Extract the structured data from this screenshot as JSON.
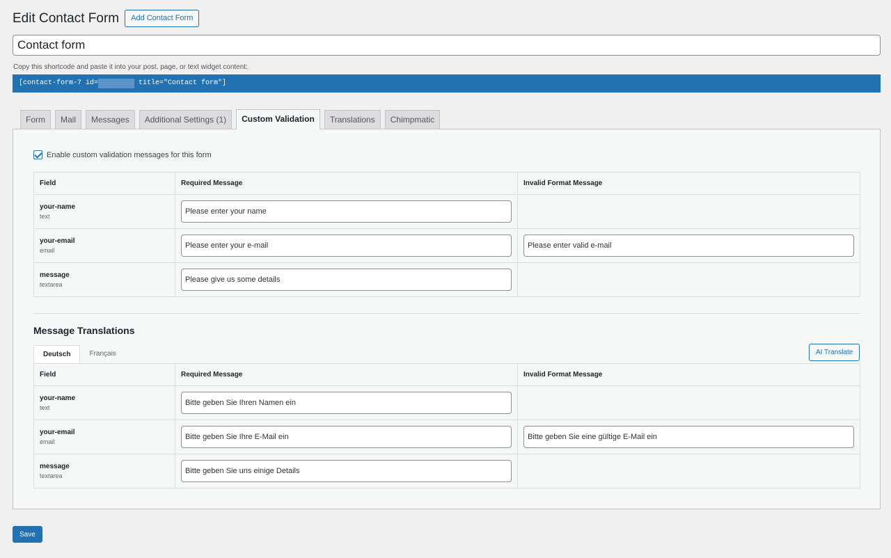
{
  "header": {
    "title": "Edit Contact Form",
    "add_button": "Add Contact Form"
  },
  "form_title": "Contact form",
  "shortcode": {
    "hint": "Copy this shortcode and paste it into your post, page, or text widget content:",
    "prefix": "[contact-form-7 id=",
    "suffix": " title=\"Contact form\"]"
  },
  "tabs": [
    {
      "label": "Form"
    },
    {
      "label": "Mail"
    },
    {
      "label": "Messages"
    },
    {
      "label": "Additional Settings (1)"
    },
    {
      "label": "Custom Validation",
      "active": true
    },
    {
      "label": "Translations"
    },
    {
      "label": "Chimpmatic"
    }
  ],
  "custom_validation": {
    "enable_label": "Enable custom validation messages for this form",
    "enabled": true,
    "columns": [
      "Field",
      "Required Message",
      "Invalid Format Message"
    ],
    "rows": [
      {
        "field": "your-name",
        "type": "text",
        "required": "Please enter your name",
        "invalid": null
      },
      {
        "field": "your-email",
        "type": "email",
        "required": "Please enter your e-mail",
        "invalid": "Please enter valid e-mail"
      },
      {
        "field": "message",
        "type": "textarea",
        "required": "Please give us some details",
        "invalid": null
      }
    ]
  },
  "translations": {
    "title": "Message Translations",
    "languages": [
      {
        "label": "Deutsch",
        "active": true
      },
      {
        "label": "Français"
      }
    ],
    "ai_button": "AI Translate",
    "columns": [
      "Field",
      "Required Message",
      "Invalid Format Message"
    ],
    "rows": [
      {
        "field": "your-name",
        "type": "text",
        "required": "Bitte geben Sie Ihren Namen ein",
        "invalid": null
      },
      {
        "field": "your-email",
        "type": "email",
        "required": "Bitte geben Sie Ihre E-Mail ein",
        "invalid": "Bitte geben Sie eine gültige E-Mail ein"
      },
      {
        "field": "message",
        "type": "textarea",
        "required": "Bitte geben Sie uns einige Details",
        "invalid": null
      }
    ]
  },
  "save_label": "Save",
  "colors": {
    "accent": "#2271b1",
    "background": "#f0f0f1"
  }
}
